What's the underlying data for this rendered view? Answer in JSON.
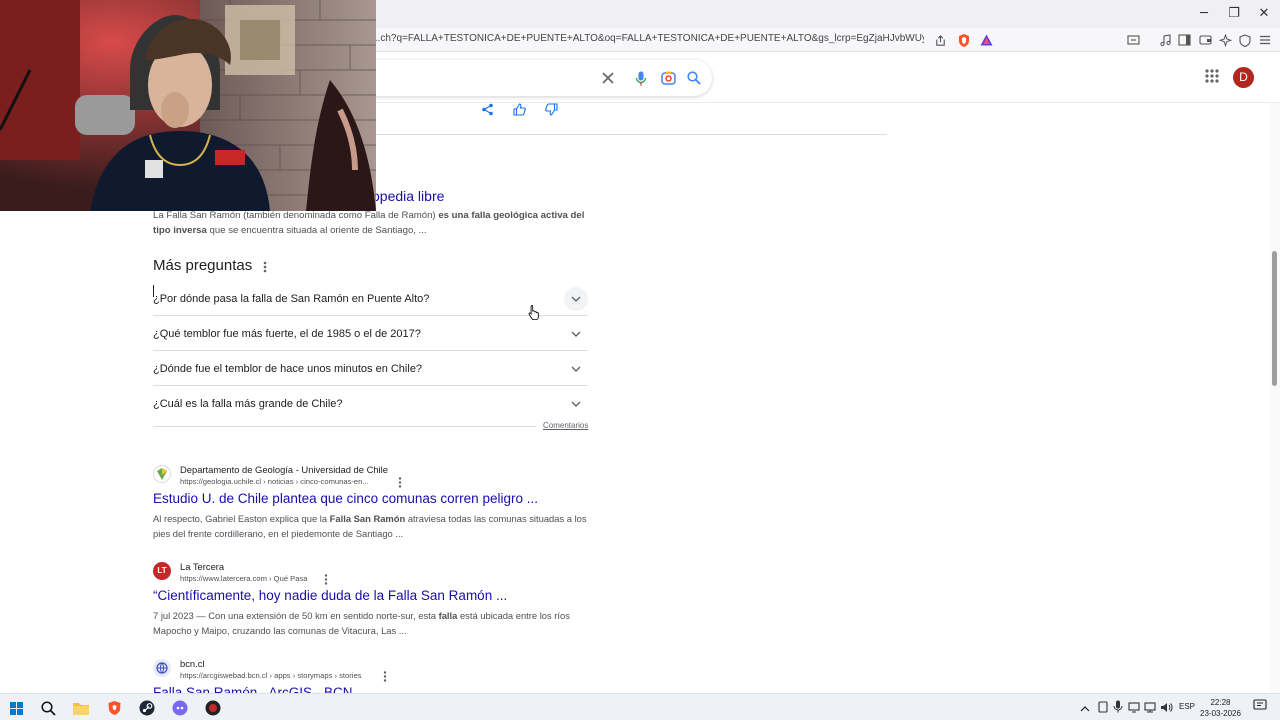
{
  "browser": {
    "url": "...ch?q=FALLA+TESTONICA+DE+PUENTE+ALTO&oq=FALLA+TESTONICA+DE+PUENTE+ALTO&gs_lcrp=EgZjaHJvbWUyBggAEEUYOTI..."
  },
  "account": {
    "initial": "D"
  },
  "wiki": {
    "title_partial": "opedia libre",
    "snippet_pre": "La Falla San Ramón (también denominada como Falla de Ramón) ",
    "snippet_bold": "es una falla geológica activa del tipo inversa",
    "snippet_post": " que se encuentra situada al oriente de Santiago, ..."
  },
  "paa": {
    "heading": "Más preguntas",
    "questions": [
      "¿Por dónde pasa la falla de San Ramón en Puente Alto?",
      "¿Qué temblor fue más fuerte, el de 1985 o el de 2017?",
      "¿Dónde fue el temblor de hace unos minutos en Chile?",
      "¿Cuál es la falla más grande de Chile?"
    ],
    "feedback": "Comentarios"
  },
  "results": [
    {
      "source": "Departamento de Geología - Universidad de Chile",
      "cite": "https://geologia.uchile.cl › noticias › cinco-comunas-en...",
      "title": "Estudio U. de Chile plantea que cinco comunas corren peligro ...",
      "snippet_a": "Al respecto, Gabriel Easton explica que la ",
      "snippet_b": "Falla San Ramón",
      "snippet_c": " atraviesa todas las comunas situadas a los pies del frente cordillerano, en el piedemonte de Santiago ...",
      "favicon_color": "#6aa84f"
    },
    {
      "source": "La Tercera",
      "cite": "https://www.latercera.com › Qué Pasa",
      "title": "“Científicamente, hoy nadie duda de la Falla San Ramón ...",
      "snippet_a": "7 jul 2023 — Con una extensión de 50 km en sentido norte-sur, esta ",
      "snippet_b": "falla",
      "snippet_c": " está ubicada entre los ríos Mapocho y Maipo, cruzando las comunas de Vitacura, Las ...",
      "favicon_text": "LT",
      "favicon_color": "#c62828"
    },
    {
      "source": "bcn.cl",
      "cite": "https://arcgiswebad.bcn.cl › apps › storymaps › stories",
      "title": "Falla San Ramón - ArcGIS - BCN",
      "favicon_color": "#e8eaf6"
    }
  ],
  "taskbar": {
    "lang": "ESP",
    "time": "22:28",
    "date": "23-03-2026"
  },
  "colors": {
    "link": "#1a0dab",
    "avatar": "#b3261e",
    "brave": "#fb542b"
  }
}
